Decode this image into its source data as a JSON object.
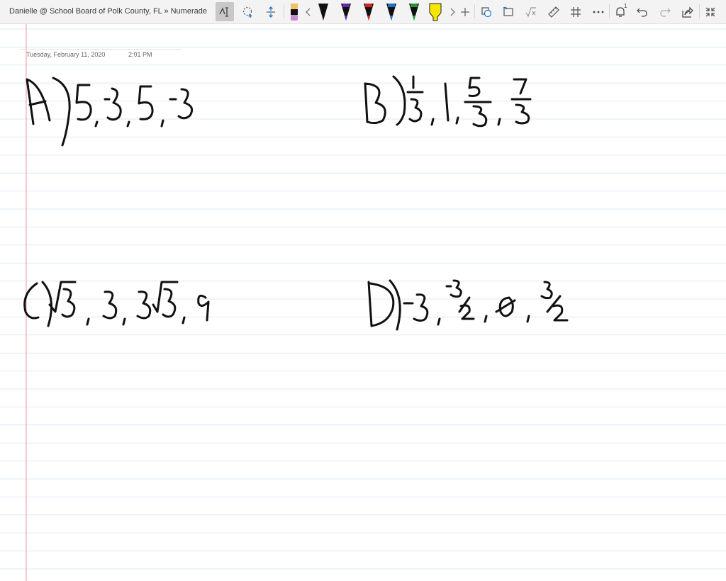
{
  "header": {
    "breadcrumb": "Danielle @ School Board of Polk County, FL » Numerade"
  },
  "toolbar": {
    "icons": [
      "ink-to-text-icon",
      "lasso-select-icon",
      "add-space-icon",
      "pen-icon",
      "pen-icon",
      "pen-icon",
      "pen-icon",
      "pen-icon",
      "pen-icon",
      "highlighter-icon",
      "add-pen-icon",
      "shapes-icon",
      "ink-to-shape-icon",
      "math-icon",
      "ruler-icon",
      "grid-icon",
      "more-icon",
      "notifications-icon",
      "undo-icon",
      "redo-icon",
      "share-icon",
      "fullscreen-icon"
    ],
    "pen_colors": [
      "#e8b4e6",
      "#000000",
      "#000000",
      "#6a2aa8",
      "#d92020",
      "#1a6fd1",
      "#1f9a3a",
      "#f5e600"
    ],
    "notification_count": "1"
  },
  "note": {
    "date": "Tuesday, February 11, 2020",
    "time": "2:01 PM"
  },
  "colors": {
    "rule_line": "#dbe8f7",
    "margin_line": "#f4a6a6",
    "ink": "#111111"
  }
}
